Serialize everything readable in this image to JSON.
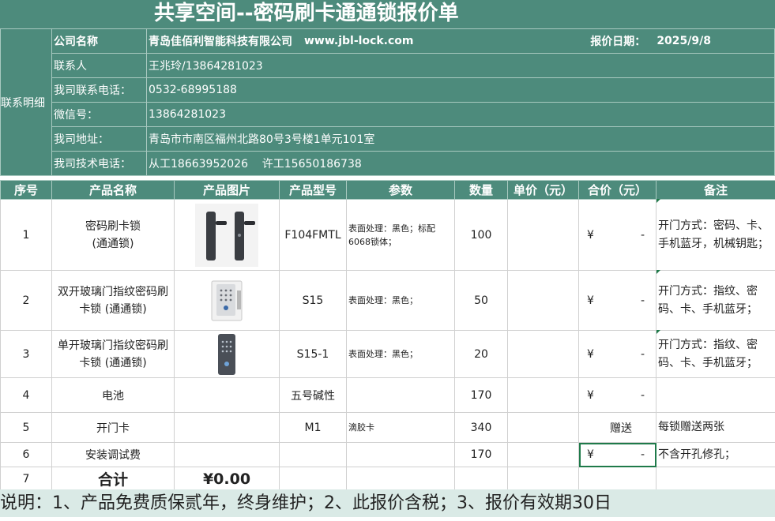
{
  "title": "共享空间--密码刷卡通通锁报价单",
  "contact": {
    "section_label": "联系明细",
    "company_label": "公司名称",
    "company_name": "青岛佳佰利智能科技有限公司",
    "website": "www.jbl-lock.com",
    "date_label": "报价日期：",
    "date_value": "2025/9/8",
    "contact_label": "联系人",
    "contact_value": "王兆玲/13864281023",
    "phone_label": "我司联系电话：",
    "phone_value": "0532-68995188",
    "wechat_label": "微信号：",
    "wechat_value": "13864281023",
    "address_label": "我司地址：",
    "address_value": "青岛市市南区福州北路80号3号楼1单元101室",
    "tech_label": "我司技术电话：",
    "tech_value": "从工18663952026    许工15650186738"
  },
  "headers": [
    "序号",
    "产品名称",
    "产品图片",
    "产品型号",
    "参数",
    "数量",
    "单价（元）",
    "合价（元）",
    "备注"
  ],
  "rows": [
    {
      "no": "1",
      "name": "密码刷卡锁\n(通通锁)",
      "model": "F104FMTL",
      "params": "表面处理：黑色；标配6068锁体；",
      "qty": "100",
      "price": "",
      "yen": "¥",
      "amount": "-",
      "note": "开门方式：密码、卡、手机蓝牙，机械钥匙；",
      "image": "lever-lock-icon"
    },
    {
      "no": "2",
      "name": "双开玻璃门指纹密码刷卡锁  (通通锁)",
      "model": "S15",
      "params": "表面处理：黑色；",
      "qty": "50",
      "price": "",
      "yen": "¥",
      "amount": "-",
      "note": "开门方式：指纹、密码、卡、手机蓝牙；",
      "image": "glass-door-lock-icon"
    },
    {
      "no": "3",
      "name": "单开玻璃门指纹密码刷卡锁  (通通锁)",
      "model": "S15-1",
      "params": "表面处理：黑色；",
      "qty": "20",
      "price": "",
      "yen": "¥",
      "amount": "-",
      "note": "开门方式：指纹、密码、卡、手机蓝牙；",
      "image": "single-glass-lock-icon"
    },
    {
      "no": "4",
      "name": "电池",
      "model": "五号碱性",
      "params": "",
      "qty": "170",
      "price": "",
      "yen": "¥",
      "amount": "-",
      "note": ""
    },
    {
      "no": "5",
      "name": "开门卡",
      "model": "M1",
      "params": "滴胶卡",
      "qty": "340",
      "price": "",
      "gift": "赠送",
      "note": "每锁赠送两张"
    },
    {
      "no": "6",
      "name": "安装调试费",
      "model": "",
      "params": "",
      "qty": "170",
      "price": "",
      "yen": "¥",
      "amount": "-",
      "note": "不含开孔修孔；"
    }
  ],
  "total": {
    "no": "7",
    "label": "合计",
    "value": "¥0.00"
  },
  "footer": "说明：1、产品免费质保贰年，终身维护；2、此报价含税；3、报价有效期30日"
}
